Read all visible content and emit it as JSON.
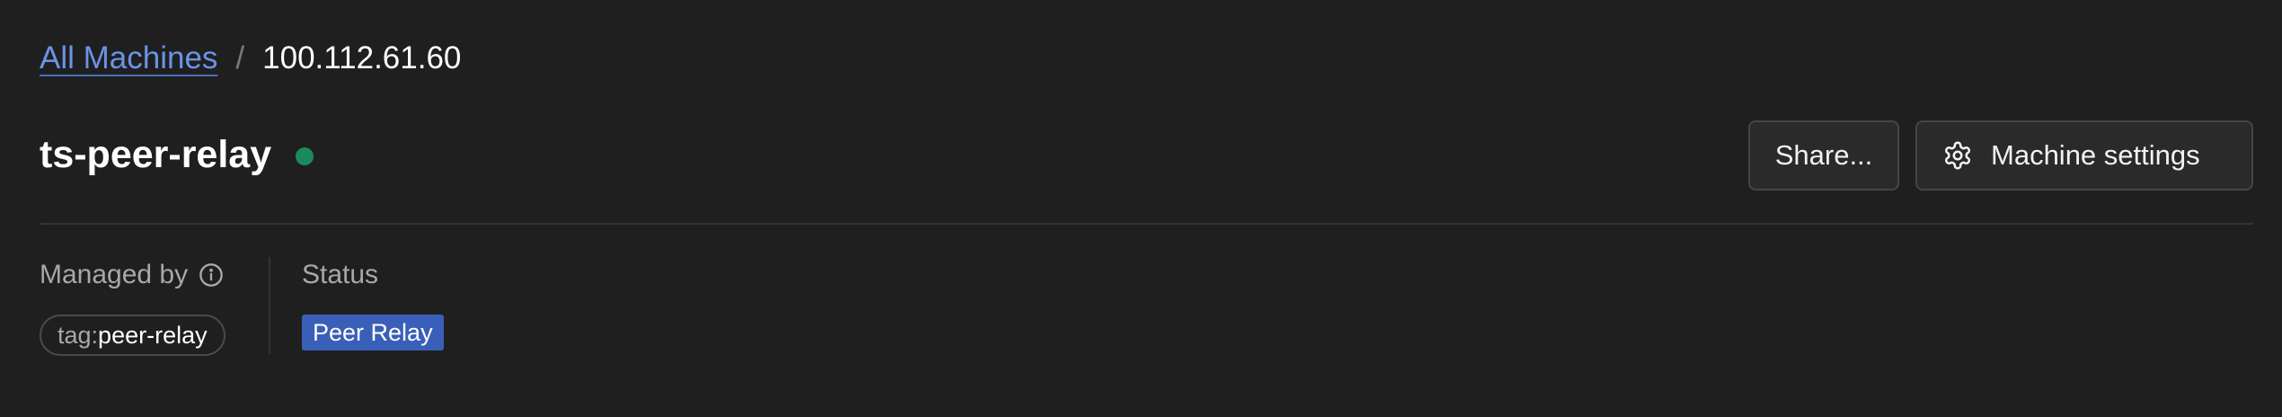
{
  "breadcrumb": {
    "parent": "All Machines",
    "separator": "/",
    "current": "100.112.61.60"
  },
  "machine": {
    "name": "ts-peer-relay",
    "online_status_color": "#1a8a5c"
  },
  "actions": {
    "share_label": "Share...",
    "settings_label": "Machine settings",
    "settings_icon": "gear-icon"
  },
  "managed_by": {
    "label": "Managed by",
    "info_icon": "info-icon",
    "tag_prefix": "tag:",
    "tag_value": "peer-relay"
  },
  "status": {
    "label": "Status",
    "badge": "Peer Relay",
    "badge_color": "#3a5fb8"
  },
  "colors": {
    "background": "#1f1f1f",
    "link": "#6b93e6"
  }
}
